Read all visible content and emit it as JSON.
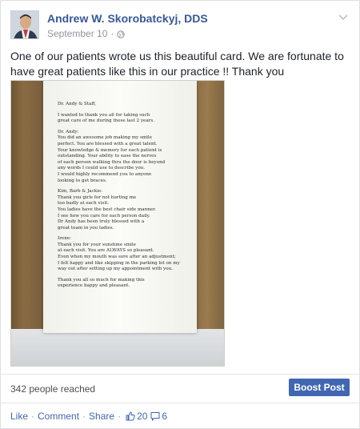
{
  "post": {
    "author": "Andrew W. Skorobatckyj, DDS",
    "date": "September 10",
    "date_separator": "·",
    "privacy_icon": "globe-icon",
    "menu_icon": "chevron-down-icon",
    "text": "One of our patients wrote us this beautiful card. We are fortunate to have great patients like this in our practice !! Thank you"
  },
  "letter": {
    "greeting": "Dr. Andy & Staff,",
    "p1": [
      "I wanted to thank you all for taking such",
      "great care of me during these last 2 years."
    ],
    "p2": [
      "Dr. Andy:",
      "You did an awesome job making my smile",
      "perfect. You are blessed with a great talent.",
      "Your knowledge & memory for each patient is",
      "outstanding. Your ability to ease the nerves",
      "of each person walking thru the door is beyond",
      "any words I could use to describe you.",
      "I would highly recommend you to anyone",
      "looking to get braces."
    ],
    "p3": [
      "Kim, Barb & Jackie:",
      "Thank you girls for not hurting me",
      "too badly at each visit.",
      "You ladies have the best chair side manner.",
      "I see how you care for each person daily.",
      "Dr Andy has been truly blessed with a",
      "great team in you ladies."
    ],
    "p4": [
      "Irene:",
      "Thank you for your sunshine smile",
      "at each visit. You are ALWAYS so pleasant.",
      "Even when my mouth was sore after an adjustment;",
      "I felt happy and like skipping in the parking lot on my",
      "way out after setting up my appointment with you."
    ],
    "p5": [
      "Thank you all so much for making this",
      "experience happy and pleasant."
    ]
  },
  "stats": {
    "reached": "342 people reached",
    "boost_label": "Boost Post"
  },
  "actions": {
    "like": "Like",
    "comment": "Comment",
    "share": "Share",
    "separator": "·",
    "likes_count": "20",
    "comments_count": "6"
  },
  "colors": {
    "link": "#365899",
    "button": "#4267b2"
  }
}
